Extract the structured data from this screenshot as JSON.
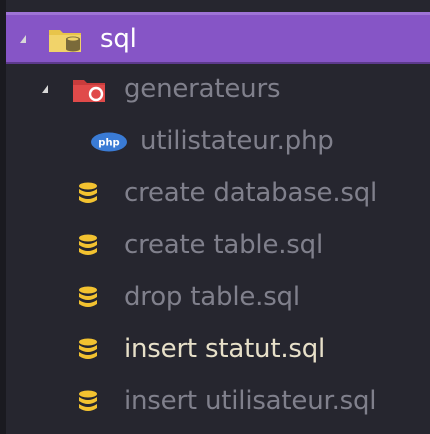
{
  "tree": {
    "root": {
      "label": "sql",
      "icon": "folder-database-icon",
      "expanded": true,
      "selected": true
    },
    "folder": {
      "label": "generateurs",
      "icon": "folder-generators-icon",
      "expanded": true
    },
    "php_file": {
      "label": "utilistateur.php",
      "badge": "php",
      "icon": "php-file-icon"
    },
    "files": [
      {
        "label": "create database.sql",
        "icon": "database-file-icon",
        "state": "dim"
      },
      {
        "label": "create table.sql",
        "icon": "database-file-icon",
        "state": "dim"
      },
      {
        "label": "drop table.sql",
        "icon": "database-file-icon",
        "state": "dim"
      },
      {
        "label": "insert statut.sql",
        "icon": "database-file-icon",
        "state": "active"
      },
      {
        "label": "insert utilisateur.sql",
        "icon": "database-file-icon",
        "state": "dim"
      }
    ]
  },
  "colors": {
    "selection": "#8655c6",
    "background": "#26262f",
    "folder_yellow": "#e8c44a",
    "folder_red": "#e04a4a",
    "php_blue": "#3a7bd5",
    "db_yellow": "#f2c230"
  }
}
